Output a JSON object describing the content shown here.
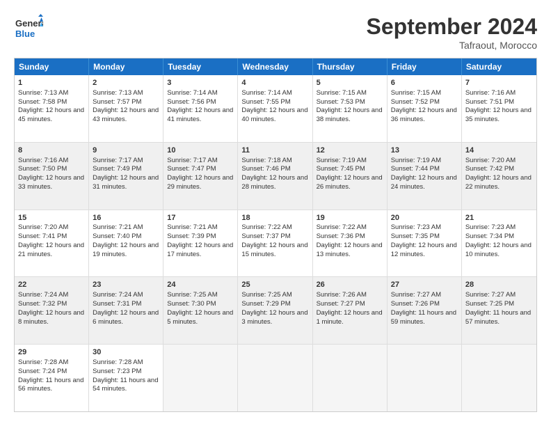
{
  "header": {
    "logo_line1": "General",
    "logo_line2": "Blue",
    "month": "September 2024",
    "location": "Tafraout, Morocco"
  },
  "weekdays": [
    "Sunday",
    "Monday",
    "Tuesday",
    "Wednesday",
    "Thursday",
    "Friday",
    "Saturday"
  ],
  "rows": [
    [
      {
        "day": "",
        "empty": true
      },
      {
        "day": "",
        "empty": true
      },
      {
        "day": "",
        "empty": true
      },
      {
        "day": "",
        "empty": true
      },
      {
        "day": "",
        "empty": true
      },
      {
        "day": "",
        "empty": true
      },
      {
        "day": "",
        "empty": true
      }
    ],
    [
      {
        "day": "1",
        "sr": "Sunrise: 7:13 AM",
        "ss": "Sunset: 7:58 PM",
        "dl": "Daylight: 12 hours and 45 minutes."
      },
      {
        "day": "2",
        "sr": "Sunrise: 7:13 AM",
        "ss": "Sunset: 7:57 PM",
        "dl": "Daylight: 12 hours and 43 minutes."
      },
      {
        "day": "3",
        "sr": "Sunrise: 7:14 AM",
        "ss": "Sunset: 7:56 PM",
        "dl": "Daylight: 12 hours and 41 minutes."
      },
      {
        "day": "4",
        "sr": "Sunrise: 7:14 AM",
        "ss": "Sunset: 7:55 PM",
        "dl": "Daylight: 12 hours and 40 minutes."
      },
      {
        "day": "5",
        "sr": "Sunrise: 7:15 AM",
        "ss": "Sunset: 7:53 PM",
        "dl": "Daylight: 12 hours and 38 minutes."
      },
      {
        "day": "6",
        "sr": "Sunrise: 7:15 AM",
        "ss": "Sunset: 7:52 PM",
        "dl": "Daylight: 12 hours and 36 minutes."
      },
      {
        "day": "7",
        "sr": "Sunrise: 7:16 AM",
        "ss": "Sunset: 7:51 PM",
        "dl": "Daylight: 12 hours and 35 minutes."
      }
    ],
    [
      {
        "day": "8",
        "sr": "Sunrise: 7:16 AM",
        "ss": "Sunset: 7:50 PM",
        "dl": "Daylight: 12 hours and 33 minutes."
      },
      {
        "day": "9",
        "sr": "Sunrise: 7:17 AM",
        "ss": "Sunset: 7:49 PM",
        "dl": "Daylight: 12 hours and 31 minutes."
      },
      {
        "day": "10",
        "sr": "Sunrise: 7:17 AM",
        "ss": "Sunset: 7:47 PM",
        "dl": "Daylight: 12 hours and 29 minutes."
      },
      {
        "day": "11",
        "sr": "Sunrise: 7:18 AM",
        "ss": "Sunset: 7:46 PM",
        "dl": "Daylight: 12 hours and 28 minutes."
      },
      {
        "day": "12",
        "sr": "Sunrise: 7:19 AM",
        "ss": "Sunset: 7:45 PM",
        "dl": "Daylight: 12 hours and 26 minutes."
      },
      {
        "day": "13",
        "sr": "Sunrise: 7:19 AM",
        "ss": "Sunset: 7:44 PM",
        "dl": "Daylight: 12 hours and 24 minutes."
      },
      {
        "day": "14",
        "sr": "Sunrise: 7:20 AM",
        "ss": "Sunset: 7:42 PM",
        "dl": "Daylight: 12 hours and 22 minutes."
      }
    ],
    [
      {
        "day": "15",
        "sr": "Sunrise: 7:20 AM",
        "ss": "Sunset: 7:41 PM",
        "dl": "Daylight: 12 hours and 21 minutes."
      },
      {
        "day": "16",
        "sr": "Sunrise: 7:21 AM",
        "ss": "Sunset: 7:40 PM",
        "dl": "Daylight: 12 hours and 19 minutes."
      },
      {
        "day": "17",
        "sr": "Sunrise: 7:21 AM",
        "ss": "Sunset: 7:39 PM",
        "dl": "Daylight: 12 hours and 17 minutes."
      },
      {
        "day": "18",
        "sr": "Sunrise: 7:22 AM",
        "ss": "Sunset: 7:37 PM",
        "dl": "Daylight: 12 hours and 15 minutes."
      },
      {
        "day": "19",
        "sr": "Sunrise: 7:22 AM",
        "ss": "Sunset: 7:36 PM",
        "dl": "Daylight: 12 hours and 13 minutes."
      },
      {
        "day": "20",
        "sr": "Sunrise: 7:23 AM",
        "ss": "Sunset: 7:35 PM",
        "dl": "Daylight: 12 hours and 12 minutes."
      },
      {
        "day": "21",
        "sr": "Sunrise: 7:23 AM",
        "ss": "Sunset: 7:34 PM",
        "dl": "Daylight: 12 hours and 10 minutes."
      }
    ],
    [
      {
        "day": "22",
        "sr": "Sunrise: 7:24 AM",
        "ss": "Sunset: 7:32 PM",
        "dl": "Daylight: 12 hours and 8 minutes."
      },
      {
        "day": "23",
        "sr": "Sunrise: 7:24 AM",
        "ss": "Sunset: 7:31 PM",
        "dl": "Daylight: 12 hours and 6 minutes."
      },
      {
        "day": "24",
        "sr": "Sunrise: 7:25 AM",
        "ss": "Sunset: 7:30 PM",
        "dl": "Daylight: 12 hours and 5 minutes."
      },
      {
        "day": "25",
        "sr": "Sunrise: 7:25 AM",
        "ss": "Sunset: 7:29 PM",
        "dl": "Daylight: 12 hours and 3 minutes."
      },
      {
        "day": "26",
        "sr": "Sunrise: 7:26 AM",
        "ss": "Sunset: 7:27 PM",
        "dl": "Daylight: 12 hours and 1 minute."
      },
      {
        "day": "27",
        "sr": "Sunrise: 7:27 AM",
        "ss": "Sunset: 7:26 PM",
        "dl": "Daylight: 11 hours and 59 minutes."
      },
      {
        "day": "28",
        "sr": "Sunrise: 7:27 AM",
        "ss": "Sunset: 7:25 PM",
        "dl": "Daylight: 11 hours and 57 minutes."
      }
    ],
    [
      {
        "day": "29",
        "sr": "Sunrise: 7:28 AM",
        "ss": "Sunset: 7:24 PM",
        "dl": "Daylight: 11 hours and 56 minutes."
      },
      {
        "day": "30",
        "sr": "Sunrise: 7:28 AM",
        "ss": "Sunset: 7:23 PM",
        "dl": "Daylight: 11 hours and 54 minutes."
      },
      {
        "day": "",
        "empty": true
      },
      {
        "day": "",
        "empty": true
      },
      {
        "day": "",
        "empty": true
      },
      {
        "day": "",
        "empty": true
      },
      {
        "day": "",
        "empty": true
      }
    ]
  ]
}
